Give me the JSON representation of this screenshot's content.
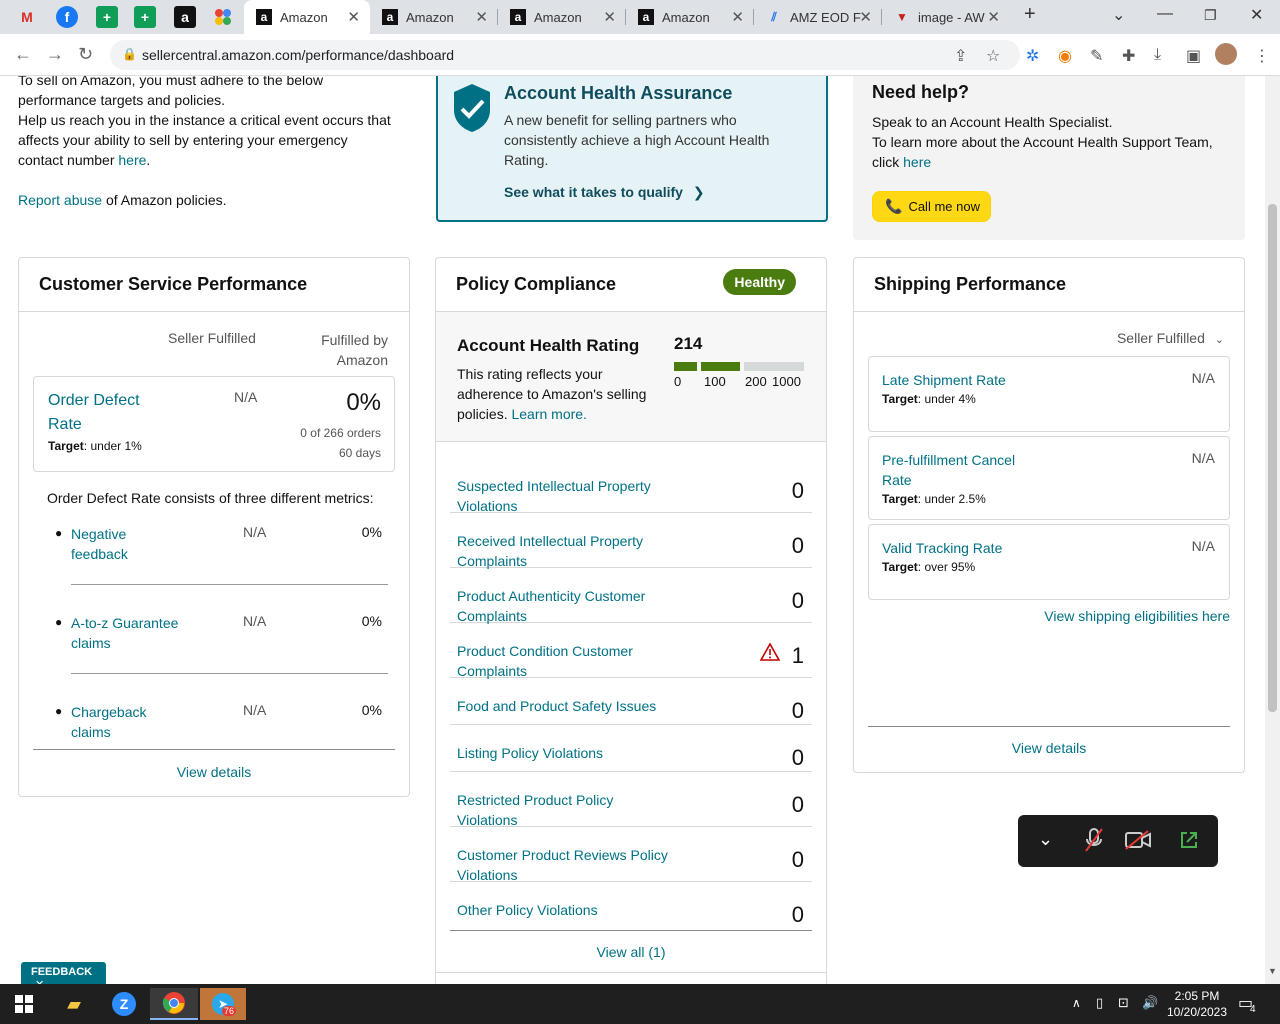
{
  "browser": {
    "tabs": [
      {
        "label": "Amazon",
        "active": true
      },
      {
        "label": "Amazon",
        "active": false
      },
      {
        "label": "Amazon",
        "active": false
      },
      {
        "label": "Amazon",
        "active": false
      },
      {
        "label": "AMZ EOD F",
        "active": false
      },
      {
        "label": "image - AW",
        "active": false
      }
    ],
    "url": "sellercentral.amazon.com/performance/dashboard"
  },
  "intro": {
    "line1": "To sell on Amazon, you must adhere to the below",
    "line2": "performance targets and policies.",
    "line3": "Help us reach you in the instance a critical event occurs that",
    "line4": "affects your ability to sell by entering your emergency",
    "line5_text": "contact number ",
    "line5_link": "here",
    "line5_end": ".",
    "report_link": "Report abuse",
    "report_text": " of Amazon policies."
  },
  "aha": {
    "title": "Account Health Assurance",
    "desc1": "A new benefit for selling partners who",
    "desc2": "consistently achieve a high Account Health",
    "desc3": "Rating.",
    "cta": "See what it takes to qualify"
  },
  "help": {
    "title": "Need help?",
    "line1": "Speak to an Account Health Specialist.",
    "line2": "To learn more about the Account Health Support Team,",
    "line3_text": "click ",
    "line3_link": "here",
    "call_button": "Call me now"
  },
  "csp": {
    "title": "Customer Service Performance",
    "col1": "Seller Fulfilled",
    "col2a": "Fulfilled by",
    "col2b": "Amazon",
    "odr_label1": "Order Defect",
    "odr_label2": "Rate",
    "odr_target_label": "Target",
    "odr_target": ": under 1%",
    "odr_seller": "N/A",
    "odr_value": "0%",
    "odr_orders": "0 of 266 orders",
    "odr_days": "60 days",
    "consists": "Order Defect Rate consists of three different metrics:",
    "metrics": [
      {
        "label1": "Negative",
        "label2": "feedback",
        "seller": "N/A",
        "fba": "0%"
      },
      {
        "label1": "A-to-z Guarantee",
        "label2": "claims",
        "seller": "N/A",
        "fba": "0%"
      },
      {
        "label1": "Chargeback",
        "label2": "claims",
        "seller": "N/A",
        "fba": "0%"
      }
    ],
    "view_details": "View details"
  },
  "policy": {
    "title": "Policy Compliance",
    "badge": "Healthy",
    "ahr_title": "Account Health Rating",
    "ahr_value": "214",
    "ahr_fill_fraction": 0.214,
    "scale": [
      "0",
      "100",
      "200",
      "1000"
    ],
    "ahr_desc1": "This rating reflects your",
    "ahr_desc2": "adherence to Amazon's selling",
    "ahr_desc3": "policies. ",
    "ahr_learn": "Learn more.",
    "items": [
      {
        "label1": "Suspected Intellectual Property",
        "label2": "Violations",
        "count": "0",
        "warn": false
      },
      {
        "label1": "Received Intellectual Property",
        "label2": "Complaints",
        "count": "0",
        "warn": false
      },
      {
        "label1": "Product Authenticity Customer",
        "label2": "Complaints",
        "count": "0",
        "warn": false
      },
      {
        "label1": "Product Condition Customer",
        "label2": "Complaints",
        "count": "1",
        "warn": true
      },
      {
        "label1": "Food and Product Safety Issues",
        "label2": "",
        "count": "0",
        "warn": false
      },
      {
        "label1": "Listing Policy Violations",
        "label2": "",
        "count": "0",
        "warn": false
      },
      {
        "label1": "Restricted Product Policy",
        "label2": "Violations",
        "count": "0",
        "warn": false
      },
      {
        "label1": "Customer Product Reviews Policy",
        "label2": "Violations",
        "count": "0",
        "warn": false
      },
      {
        "label1": "Other Policy Violations",
        "label2": "",
        "count": "0",
        "warn": false
      }
    ],
    "view_all": "View all (1)"
  },
  "shipping": {
    "title": "Shipping Performance",
    "filter": "Seller Fulfilled",
    "metrics": [
      {
        "label1": "Late Shipment Rate",
        "label2": "",
        "target": ": under 4%",
        "value": "N/A"
      },
      {
        "label1": "Pre-fulfillment Cancel",
        "label2": "Rate",
        "target": ": under 2.5%",
        "value": "N/A"
      },
      {
        "label1": "Valid Tracking Rate",
        "label2": "",
        "target": ": over 95%",
        "value": "N/A"
      }
    ],
    "target_label": "Target",
    "eligibilities": "View shipping eligibilities here",
    "view_details": "View details"
  },
  "feedback": {
    "label": "FEEDBACK"
  },
  "taskbar": {
    "time": "2:05 PM",
    "date": "10/20/2023",
    "badge": "76",
    "notif": "4"
  },
  "colors": {
    "link": "#007185",
    "healthy": "#4b7c0f",
    "call": "#ffd814",
    "aha_bg": "#e6f3f6",
    "aha_border": "#007185"
  }
}
